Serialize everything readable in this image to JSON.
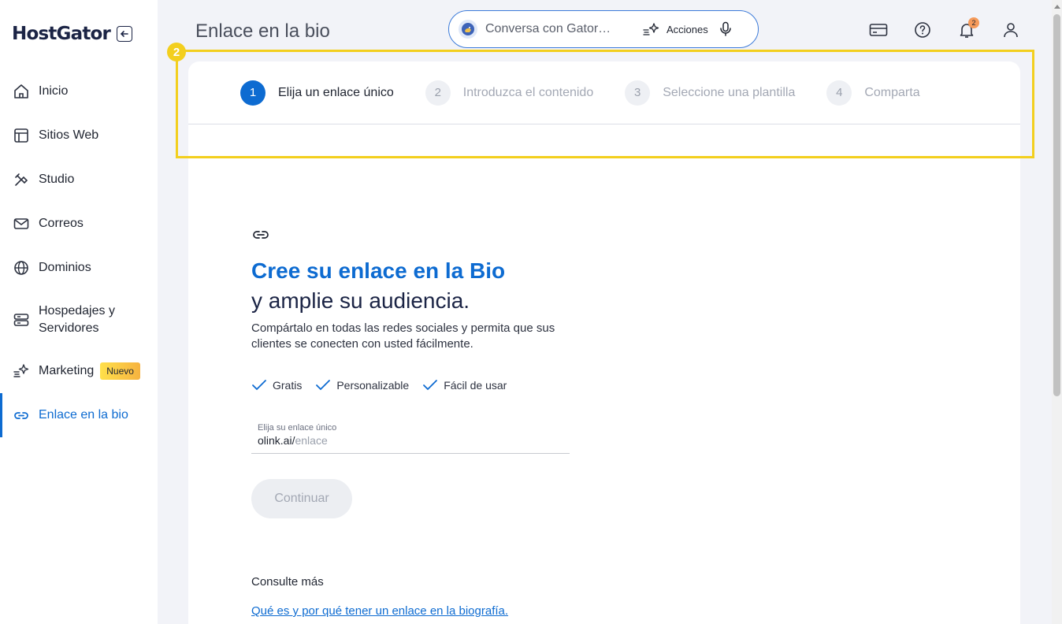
{
  "app": {
    "logo": "HostGator",
    "page_title": "Enlace en la bio"
  },
  "sidebar": {
    "items": [
      {
        "label": "Inicio",
        "icon": "home-icon"
      },
      {
        "label": "Sitios Web",
        "icon": "layout-icon"
      },
      {
        "label": "Studio",
        "icon": "studio-icon"
      },
      {
        "label": "Correos",
        "icon": "mail-icon"
      },
      {
        "label": "Dominios",
        "icon": "globe-icon"
      },
      {
        "label": "Hospedajes y Servidores",
        "icon": "server-icon"
      },
      {
        "label": "Marketing",
        "icon": "sparkle-icon",
        "badge": "Nuevo"
      },
      {
        "label": "Enlace en la bio",
        "icon": "link-icon",
        "active": true
      }
    ]
  },
  "header": {
    "assistant_placeholder": "Conversa con Gator…",
    "actions_label": "Acciones",
    "notifications_count": "2"
  },
  "highlight": {
    "number": "2",
    "color": "#f3cf1e"
  },
  "stepper": {
    "steps": [
      {
        "num": "1",
        "label": "Elija un enlace único",
        "active": true
      },
      {
        "num": "2",
        "label": "Introduzca el contenido"
      },
      {
        "num": "3",
        "label": "Seleccione una plantilla"
      },
      {
        "num": "4",
        "label": "Comparta"
      }
    ]
  },
  "main": {
    "headline_accent": "Cree su enlace en la Bio",
    "headline": "y amplie su audiencia.",
    "description": "Compártalo en todas las redes sociales y permita que sus clientes se conecten con usted fácilmente.",
    "features": [
      "Gratis",
      "Personalizable",
      "Fácil de usar"
    ],
    "field": {
      "label": "Elija su enlace único",
      "prefix": "olink.ai/",
      "placeholder": "enlace"
    },
    "continue_label": "Continuar",
    "more_title": "Consulte más",
    "more_link": "Qué es y por qué tener un enlace en la biografía."
  },
  "colors": {
    "accent": "#0d6bd1",
    "highlight": "#f3cf1e",
    "badge": "#f6b340"
  }
}
